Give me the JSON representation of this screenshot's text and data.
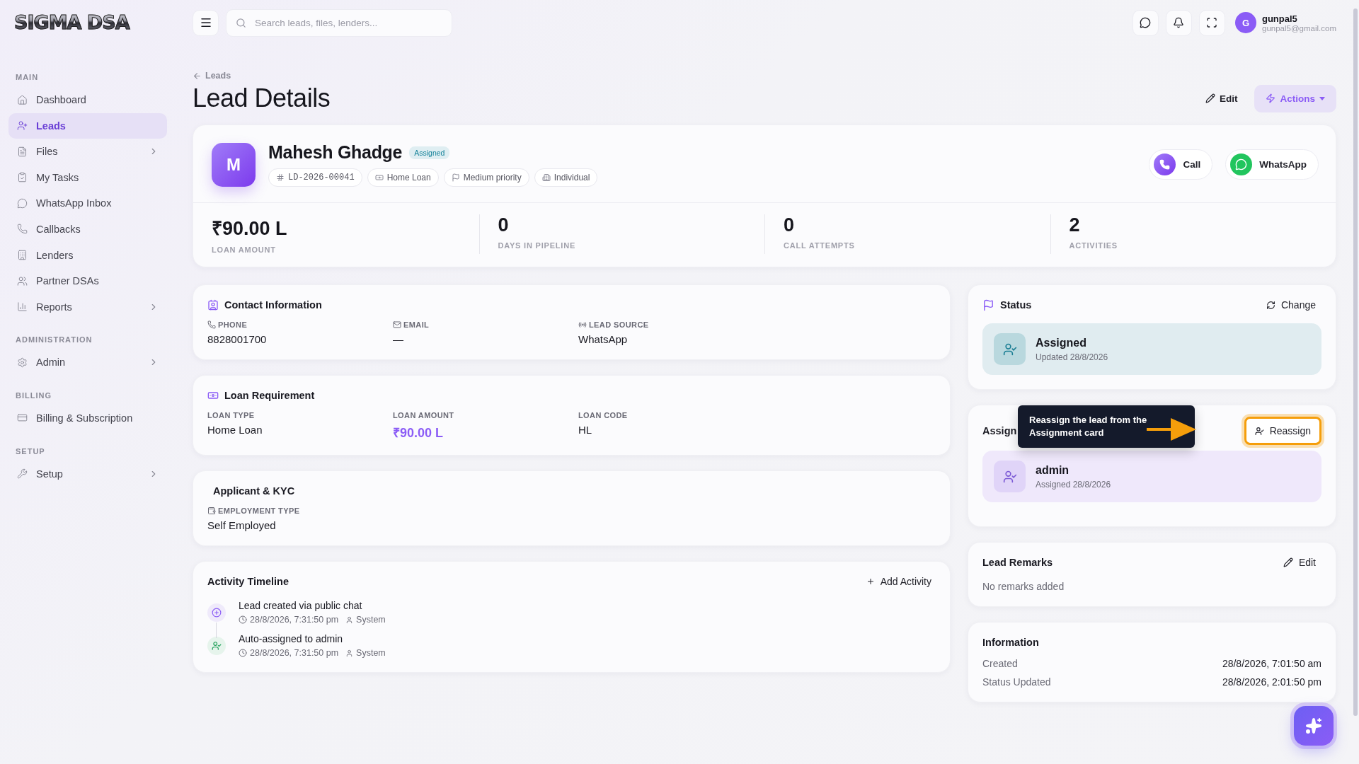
{
  "brand": {
    "logo": "SIGMA DSA"
  },
  "search": {
    "placeholder": "Search leads, files, lenders..."
  },
  "user": {
    "initial": "G",
    "name": "gunpal5",
    "email": "gunpal5@gmail.com"
  },
  "sidebar": {
    "sections": [
      {
        "title": "MAIN",
        "items": [
          {
            "label": "Dashboard",
            "selected": false,
            "expandable": false
          },
          {
            "label": "Leads",
            "selected": true,
            "expandable": false
          },
          {
            "label": "Files",
            "selected": false,
            "expandable": true
          },
          {
            "label": "My Tasks",
            "selected": false,
            "expandable": false
          },
          {
            "label": "WhatsApp Inbox",
            "selected": false,
            "expandable": false
          },
          {
            "label": "Callbacks",
            "selected": false,
            "expandable": false
          },
          {
            "label": "Lenders",
            "selected": false,
            "expandable": false
          },
          {
            "label": "Partner DSAs",
            "selected": false,
            "expandable": false
          },
          {
            "label": "Reports",
            "selected": false,
            "expandable": true
          }
        ]
      },
      {
        "title": "ADMINISTRATION",
        "items": [
          {
            "label": "Admin",
            "selected": false,
            "expandable": true
          }
        ]
      },
      {
        "title": "BILLING",
        "items": [
          {
            "label": "Billing & Subscription",
            "selected": false,
            "expandable": false
          }
        ]
      },
      {
        "title": "SETUP",
        "items": [
          {
            "label": "Setup",
            "selected": false,
            "expandable": true
          }
        ]
      }
    ]
  },
  "page": {
    "breadcrumb": "Leads",
    "title": "Lead Details",
    "edit_button": "Edit",
    "actions_button": "Actions"
  },
  "lead": {
    "initial": "M",
    "name": "Mahesh Ghadge",
    "status": "Assigned",
    "tags": [
      {
        "kind": "code",
        "label": "LD-2026-00041"
      },
      {
        "kind": "loan",
        "label": "Home Loan"
      },
      {
        "kind": "priority",
        "label": "Medium priority"
      },
      {
        "kind": "type",
        "label": "Individual"
      }
    ],
    "contact_buttons": [
      {
        "kind": "call",
        "label": "Call"
      },
      {
        "kind": "whatsapp",
        "label": "WhatsApp"
      }
    ],
    "stats": [
      {
        "value": "₹90.00 L",
        "label": "LOAN AMOUNT"
      },
      {
        "value": "0",
        "label": "DAYS IN PIPELINE"
      },
      {
        "value": "0",
        "label": "CALL ATTEMPTS"
      },
      {
        "value": "2",
        "label": "ACTIVITIES"
      }
    ]
  },
  "contact": {
    "title": "Contact Information",
    "fields": [
      {
        "kind": "phone",
        "label": "PHONE",
        "value": "8828001700"
      },
      {
        "kind": "email",
        "label": "EMAIL",
        "value": "—"
      },
      {
        "kind": "source",
        "label": "LEAD SOURCE",
        "value": "WhatsApp"
      }
    ]
  },
  "loan": {
    "title": "Loan Requirement",
    "fields": [
      {
        "kind": "text",
        "label": "LOAN TYPE",
        "value": "Home Loan"
      },
      {
        "kind": "amount",
        "label": "LOAN AMOUNT",
        "value": "₹90.00 L"
      },
      {
        "kind": "text",
        "label": "LOAN CODE",
        "value": "HL"
      }
    ]
  },
  "applicant": {
    "title": "Applicant & KYC",
    "fields": [
      {
        "kind": "employment",
        "label": "EMPLOYMENT TYPE",
        "value": "Self Employed"
      }
    ]
  },
  "activity": {
    "title": "Activity Timeline",
    "add_button": "Add Activity",
    "items": [
      {
        "kind": "created",
        "title": "Lead created via public chat",
        "time": "28/8/2026, 7:31:50 pm",
        "actor": "System"
      },
      {
        "kind": "assigned",
        "title": "Auto-assigned to admin",
        "time": "28/8/2026, 7:31:50 pm",
        "actor": "System"
      }
    ]
  },
  "status": {
    "title": "Status",
    "change_button": "Change",
    "current": "Assigned",
    "updated": "Updated 28/8/2026"
  },
  "assignment": {
    "title": "Assign",
    "reassign_button": "Reassign",
    "assignee": "admin",
    "assigned": "Assigned 28/8/2026"
  },
  "tooltip": {
    "text": "Reassign the lead from the Assignment card"
  },
  "remarks": {
    "title": "Lead Remarks",
    "edit_button": "Edit",
    "text": "No remarks added"
  },
  "information": {
    "title": "Information",
    "rows": [
      {
        "label": "Created",
        "value": "28/8/2026, 7:01:50 am"
      },
      {
        "label": "Status Updated",
        "value": "28/8/2026, 2:01:50 pm"
      }
    ]
  }
}
